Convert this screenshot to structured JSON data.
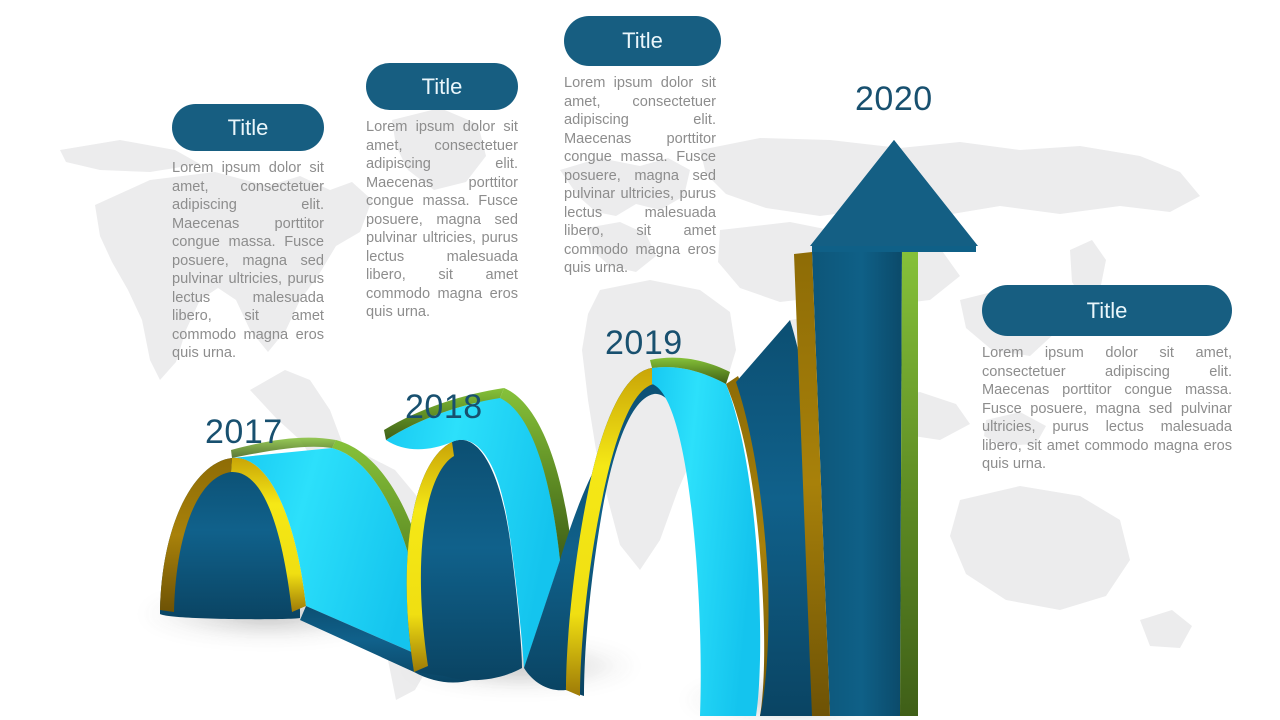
{
  "slide": {
    "background_color": "#ffffff",
    "map_color": "#eceded",
    "accent_color": "#175e81",
    "body_text_color": "#8d8d8d",
    "ribbon": {
      "inner_face_color": "#22d3f5",
      "outer_face_color": "#0f5a7e",
      "edge_color_light": "#f2e313",
      "edge_color_dark": "#a07a09",
      "edge_color_green": "#5d8a23"
    }
  },
  "years": [
    {
      "name": "year-2017",
      "label": "2017"
    },
    {
      "name": "year-2018",
      "label": "2018"
    },
    {
      "name": "year-2019",
      "label": "2019"
    },
    {
      "name": "year-2020",
      "label": "2020"
    }
  ],
  "callouts": [
    {
      "title": "Title",
      "body": "Lorem ipsum dolor sit amet, consectetuer adipiscing elit. Maecenas porttitor congue massa. Fusce posuere, magna sed pulvinar ultricies, purus lectus malesuada libero, sit amet commodo magna eros quis urna."
    },
    {
      "title": "Title",
      "body": "Lorem ipsum dolor sit amet, consectetuer adipiscing elit. Maecenas porttitor congue massa. Fusce posuere, magna sed pulvinar ultricies, purus lectus malesuada libero, sit amet commodo magna eros quis urna."
    },
    {
      "title": "Title",
      "body": "Lorem ipsum dolor sit amet, consectetuer adipiscing elit. Maecenas porttitor congue massa. Fusce posuere, magna sed pulvinar ultricies, purus lectus malesuada libero, sit amet commodo magna eros quis urna."
    },
    {
      "title": "Title",
      "body": "Lorem ipsum dolor sit amet, consectetuer adipiscing elit. Maecenas porttitor congue massa. Fusce posuere, magna sed pulvinar ultricies, purus lectus malesuada libero, sit amet commodo magna eros quis urna."
    }
  ]
}
